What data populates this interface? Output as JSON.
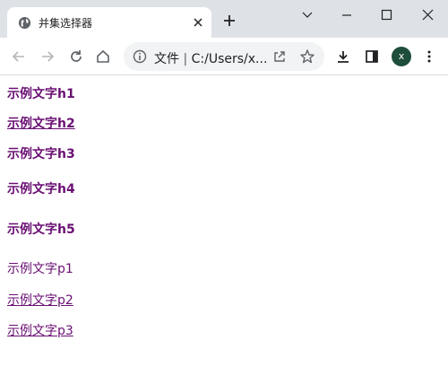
{
  "browser": {
    "tab": {
      "title": "并集选择器"
    },
    "address": {
      "scheme_label": "文件",
      "url": "C:/Users/x..."
    },
    "profile": {
      "initial": "x"
    }
  },
  "page": {
    "headings": [
      "示例文字h1",
      "示例文字h2",
      "示例文字h3",
      "示例文字h4",
      "示例文字h5"
    ],
    "paragraphs": [
      "示例文字p1",
      "示例文字p2",
      "示例文字p3"
    ]
  },
  "colors": {
    "text_purple": "#6a0f73",
    "titlebar": "#dee1e6",
    "omnibox": "#f1f3f4",
    "avatar": "#1e4d3b"
  },
  "icons": [
    "globe-icon",
    "close-icon",
    "plus-icon",
    "chevron-down-icon",
    "minimize-icon",
    "maximize-icon",
    "close-window-icon",
    "back-arrow-icon",
    "forward-arrow-icon",
    "reload-icon",
    "home-icon",
    "info-icon",
    "share-icon",
    "star-icon",
    "download-icon",
    "side-panel-icon",
    "more-vert-icon"
  ]
}
